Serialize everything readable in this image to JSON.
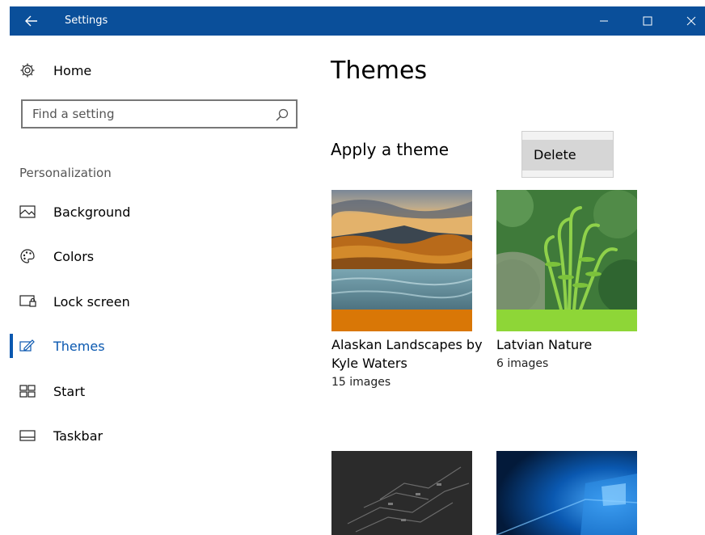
{
  "window": {
    "title": "Settings",
    "accent_color": "#0a4f9a"
  },
  "nav": {
    "home_label": "Home",
    "search_placeholder": "Find a setting",
    "section_label": "Personalization",
    "items": [
      {
        "label": "Background",
        "icon": "picture-icon"
      },
      {
        "label": "Colors",
        "icon": "palette-icon"
      },
      {
        "label": "Lock screen",
        "icon": "lock-screen-icon"
      },
      {
        "label": "Themes",
        "icon": "themes-icon",
        "selected": true
      },
      {
        "label": "Start",
        "icon": "start-icon"
      },
      {
        "label": "Taskbar",
        "icon": "taskbar-icon"
      }
    ]
  },
  "main": {
    "title": "Themes",
    "section_title": "Apply a theme",
    "context_menu": {
      "items": [
        "Delete"
      ]
    },
    "themes": [
      {
        "name": "Alaskan Landscapes by Kyle Waters",
        "count": "15 images",
        "accent": "#d97706"
      },
      {
        "name": "Latvian Nature",
        "count": "6 images",
        "accent": "#8ed637"
      },
      {
        "name": "",
        "count": "",
        "accent": "#2b2b2b"
      },
      {
        "name": "",
        "count": "",
        "accent": "#0a58b0"
      }
    ]
  }
}
